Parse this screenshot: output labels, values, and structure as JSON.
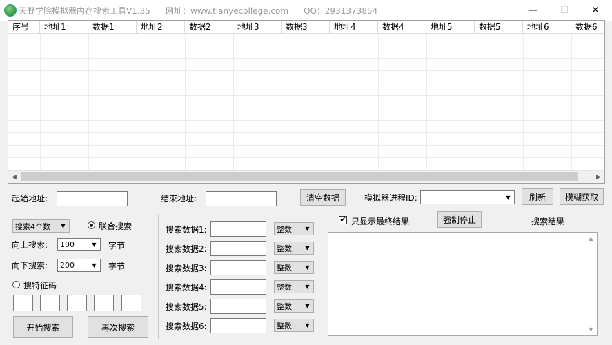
{
  "window": {
    "title": "天野学院模拟器内存搜索工具V1.35",
    "website": "网址：www.tianyecollege.com",
    "qq": "QQ：2931373854",
    "minimize": "—",
    "maximize": "☐",
    "close": "✕"
  },
  "table": {
    "columns": [
      "序号",
      "地址1",
      "数据1",
      "地址2",
      "数据2",
      "地址3",
      "数据3",
      "地址4",
      "数据4",
      "地址5",
      "数据5",
      "地址6",
      "数据6"
    ]
  },
  "top_row": {
    "start_addr_label": "起始地址:",
    "end_addr_label": "结束地址:",
    "clear_button": "清空数据",
    "process_label": "模拟器进程ID:",
    "refresh_button": "刷新",
    "fuzzy_button": "模糊获取"
  },
  "left_panel": {
    "search_count": "搜索4个数",
    "joint_search": "联合搜索",
    "up_label": "向上搜索:",
    "up_value": "100",
    "down_label": "向下搜索:",
    "down_value": "200",
    "bytes_unit": "字节",
    "feature_search": "搜特征码",
    "start_button": "开始搜索",
    "again_button": "再次搜索"
  },
  "middle_panel": {
    "rows": [
      {
        "label": "搜索数据1:",
        "type": "整数"
      },
      {
        "label": "搜索数据2:",
        "type": "整数"
      },
      {
        "label": "搜索数据3:",
        "type": "整数"
      },
      {
        "label": "搜索数据4:",
        "type": "整数"
      },
      {
        "label": "搜索数据5:",
        "type": "整数"
      },
      {
        "label": "搜索数据6:",
        "type": "整数"
      }
    ]
  },
  "right_panel": {
    "only_final_label": "只显示最终结果",
    "only_final_checked": true,
    "stop_button": "强制停止",
    "result_label": "搜索结果"
  },
  "icons": {
    "check_mark": "✔",
    "dropdown": "▼",
    "arrow_left": "◀",
    "arrow_right": "▶",
    "arrow_up": "▲",
    "arrow_down": "▼"
  }
}
